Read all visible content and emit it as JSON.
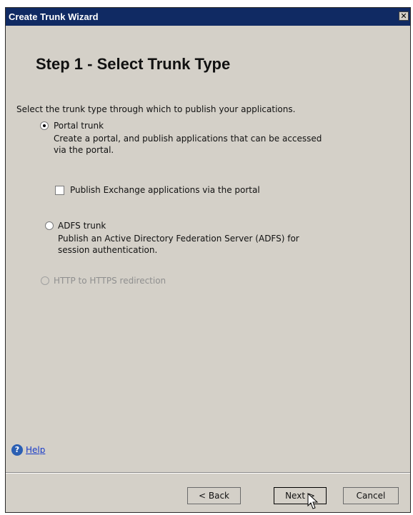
{
  "window": {
    "title": "Create Trunk Wizard",
    "close_glyph": "✕"
  },
  "step": {
    "title": "Step 1 - Select Trunk Type"
  },
  "instructions": "Select the trunk type through which to publish your applications.",
  "options": [
    {
      "label": "Portal trunk",
      "desc_line1": "Create a portal, and publish applications that can be accessed",
      "desc_line2": "via the portal.",
      "selected": true
    },
    {
      "label": "Publish Exchange applications via the portal",
      "checked": false
    },
    {
      "label": "ADFS trunk",
      "desc_line1": "Publish an Active Directory Federation Server (ADFS) for",
      "desc_line2": "session authentication.",
      "selected": false
    },
    {
      "label": "HTTP to HTTPS redirection",
      "selected": false,
      "disabled": true
    }
  ],
  "help": {
    "label": "Help",
    "icon": "help-icon"
  },
  "buttons": {
    "back": "< Back",
    "next": "Next >",
    "cancel": "Cancel"
  },
  "colors": {
    "titlebar": "#102a63",
    "dialog": "#d4d0c8",
    "link": "#1a3cc8"
  }
}
